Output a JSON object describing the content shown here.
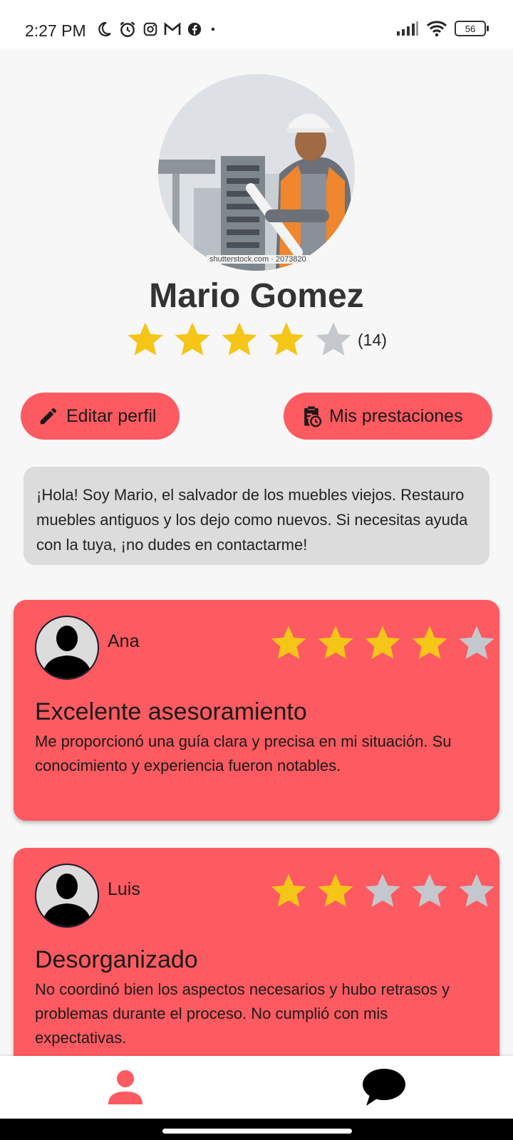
{
  "status_bar": {
    "time": "2:27 PM",
    "battery": "56",
    "left_icons": [
      "moon-icon",
      "alarm-icon",
      "instagram-icon",
      "gmail-icon",
      "facebook-icon",
      "dot-icon"
    ],
    "right_icons": [
      "signal-icon",
      "wifi-icon",
      "battery-icon"
    ]
  },
  "profile": {
    "name": "Mario Gomez",
    "rating": 4,
    "rating_max": 5,
    "rating_count": "(14)",
    "photo_watermark": "shutterstock.com · 2073820",
    "bio": "¡Hola! Soy Mario, el salvador de los muebles viejos. Restauro muebles antiguos y los dejo como nuevos. Si necesitas ayuda con la tuya, ¡no dudes en contactarme!"
  },
  "actions": {
    "edit_label": "Editar perfil",
    "services_label": "Mis prestaciones"
  },
  "reviews": [
    {
      "author": "Ana",
      "rating": 4,
      "title": "Excelente asesoramiento",
      "body": "Me proporcionó una guía clara y precisa en mi situación. Su conocimiento y experiencia fueron notables."
    },
    {
      "author": "Luis",
      "rating": 2,
      "title": "Desorganizado",
      "body": "No coordinó bien los aspectos necesarios y hubo retrasos y problemas durante el proceso. No cumplió con mis expectativas."
    }
  ],
  "colors": {
    "accent": "#fd5a61",
    "star_filled": "#f5c518",
    "star_empty": "#c4c8cc",
    "bio_background": "#dcdcdc"
  },
  "bottom_nav": {
    "items": [
      "profile-icon",
      "chat-icon"
    ]
  }
}
